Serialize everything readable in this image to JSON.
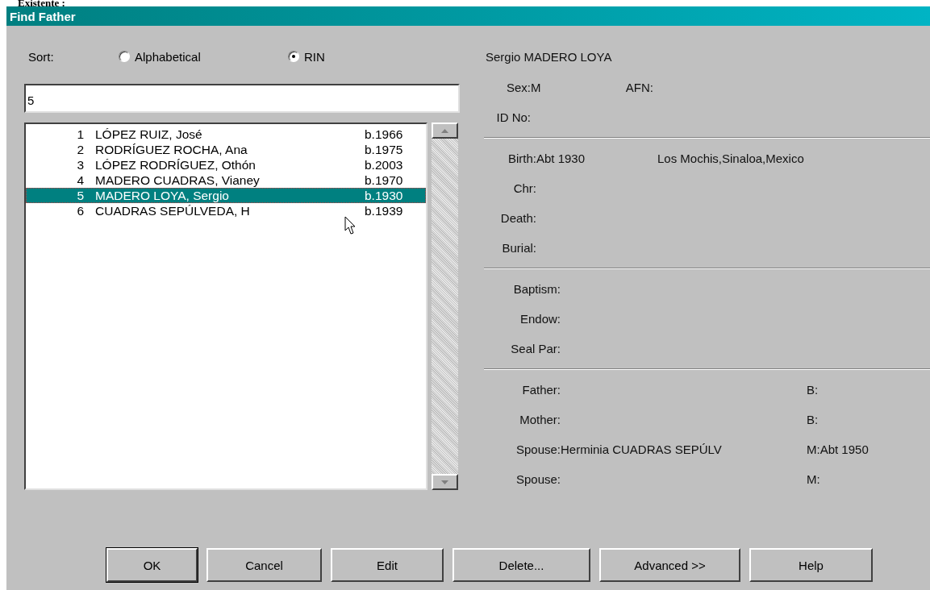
{
  "caption": "Existente :",
  "window": {
    "title": "Find Father"
  },
  "sort": {
    "label": "Sort:",
    "options": [
      {
        "label": "Alphabetical",
        "selected": false
      },
      {
        "label": "RIN",
        "selected": true
      }
    ]
  },
  "search": {
    "value": "5"
  },
  "people": [
    {
      "number": "1",
      "name": "LÓPEZ RUIZ, José",
      "born": "b.1966",
      "selected": false
    },
    {
      "number": "2",
      "name": "RODRÍGUEZ ROCHA, Ana",
      "born": "b.1975",
      "selected": false
    },
    {
      "number": "3",
      "name": "LÓPEZ RODRÍGUEZ, Othón",
      "born": "b.2003",
      "selected": false
    },
    {
      "number": "4",
      "name": "MADERO CUADRAS, Vianey",
      "born": "b.1970",
      "selected": false
    },
    {
      "number": "5",
      "name": "MADERO LOYA, Sergio",
      "born": "b.1930",
      "selected": true
    },
    {
      "number": "6",
      "name": "CUADRAS SEPÚLVEDA, H",
      "born": "b.1939",
      "selected": false
    }
  ],
  "details": {
    "name": "Sergio MADERO LOYA",
    "sections": [
      {
        "kind": "identity",
        "rows": [
          [
            {
              "label": "Sex:",
              "value": "M"
            },
            {
              "label": "AFN:"
            }
          ],
          [
            {
              "label": "ID No:"
            }
          ]
        ]
      },
      {
        "kind": "events",
        "rows": [
          [
            {
              "label": "Birth:",
              "value": "Abt 1930"
            },
            {
              "value": "Los Mochis,Sinaloa,Mexico"
            }
          ],
          [
            {
              "label": "Chr:"
            }
          ],
          [
            {
              "label": "Death:"
            }
          ],
          [
            {
              "label": "Burial:"
            }
          ]
        ]
      },
      {
        "kind": "ordinances",
        "rows": [
          [
            {
              "label": "Baptism:"
            }
          ],
          [
            {
              "label": "Endow:"
            }
          ],
          [
            {
              "label": "Seal Par:"
            }
          ]
        ]
      },
      {
        "kind": "family",
        "rows": [
          [
            {
              "label": "Father:"
            },
            {
              "label": "B:"
            }
          ],
          [
            {
              "label": "Mother:"
            },
            {
              "label": "B:"
            }
          ],
          [
            {
              "label": "Spouse:",
              "value": "Herminia CUADRAS SEPÚLV"
            },
            {
              "label": "M:",
              "value": "Abt 1950"
            }
          ],
          [
            {
              "label": "Spouse:"
            },
            {
              "label": "M:"
            }
          ]
        ]
      }
    ]
  },
  "buttons": [
    {
      "label": "OK",
      "default": true
    },
    {
      "label": "Cancel",
      "default": false
    },
    {
      "label": "Edit",
      "default": false
    },
    {
      "label": "Delete...",
      "default": false
    },
    {
      "label": "Advanced >>",
      "default": false
    },
    {
      "label": "Help",
      "default": false
    }
  ]
}
